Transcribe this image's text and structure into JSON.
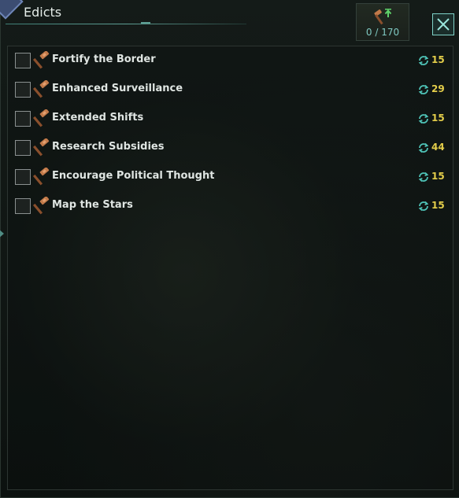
{
  "window": {
    "title": "Edicts",
    "capacity": "0 / 170",
    "capacity_icon": "gavel-up-arrow-icon",
    "close_icon": "close-icon"
  },
  "colors": {
    "accent": "#7fd3c8",
    "cost_text": "#e3cd4a",
    "cost_icon": "#4fc4b8",
    "gavel_head": "#c27a4a",
    "gavel_handle": "#8a4f2c"
  },
  "edicts": [
    {
      "label": "Fortify the Border",
      "cost": "15",
      "checked": false,
      "icon": "gavel-icon"
    },
    {
      "label": "Enhanced Surveillance",
      "cost": "29",
      "checked": false,
      "icon": "gavel-icon"
    },
    {
      "label": "Extended Shifts",
      "cost": "15",
      "checked": false,
      "icon": "gavel-icon"
    },
    {
      "label": "Research Subsidies",
      "cost": "44",
      "checked": false,
      "icon": "gavel-icon"
    },
    {
      "label": "Encourage Political Thought",
      "cost": "15",
      "checked": false,
      "icon": "gavel-icon"
    },
    {
      "label": "Map the Stars",
      "cost": "15",
      "checked": false,
      "icon": "gavel-icon"
    }
  ]
}
